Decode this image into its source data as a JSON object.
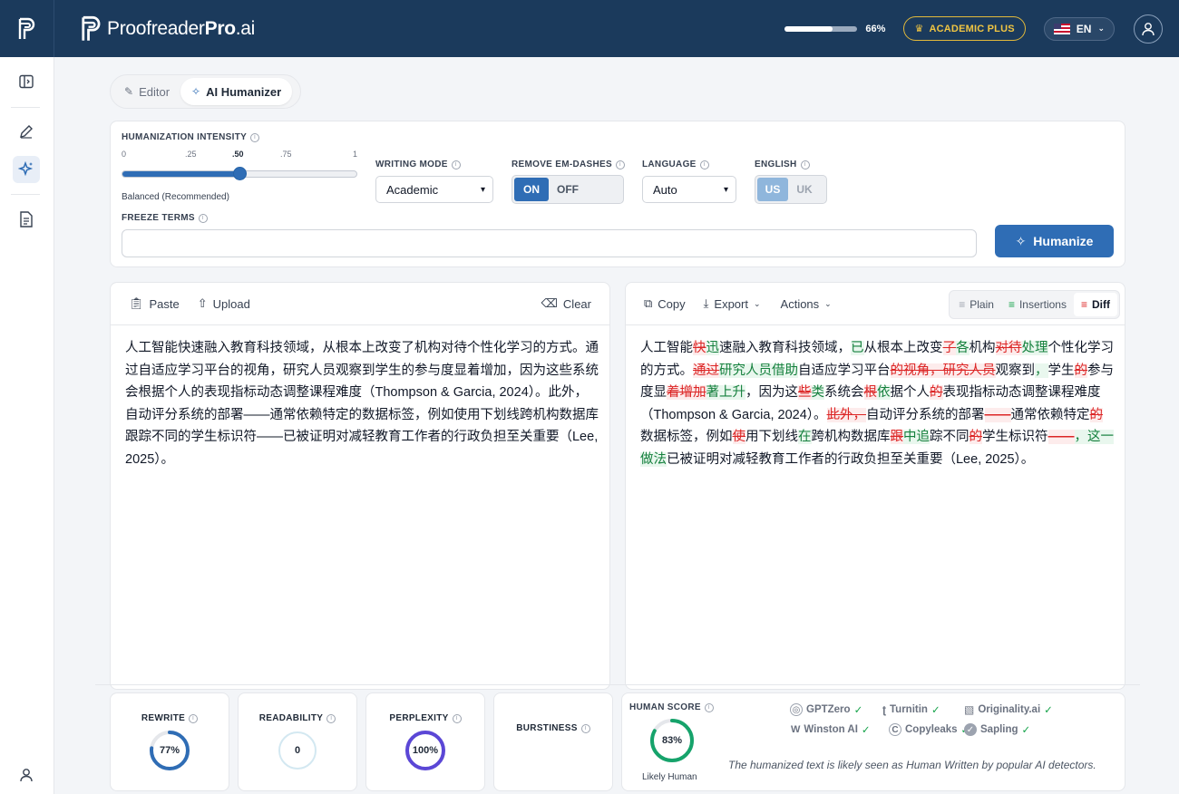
{
  "brand": {
    "name_regular": "Proofreader",
    "name_bold": "Pro",
    "name_tld": ".ai"
  },
  "topbar": {
    "credits_percent": 66,
    "credits_label": "66%",
    "plan_label": "ACADEMIC PLUS",
    "language_label": "EN"
  },
  "tabs": [
    {
      "label": "Editor"
    },
    {
      "label": "AI Humanizer"
    }
  ],
  "settings": {
    "intensity_label": "HUMANIZATION INTENSITY",
    "ticks": [
      "0",
      ".25",
      ".50",
      ".75",
      "1"
    ],
    "intensity_value": 0.5,
    "intensity_caption": "Balanced (Recommended)",
    "writing_mode_label": "WRITING MODE",
    "writing_mode_value": "Academic",
    "em_dash_label": "REMOVE EM-DASHES",
    "em_on": "ON",
    "em_off": "OFF",
    "language_label": "LANGUAGE",
    "language_value": "Auto",
    "english_label": "ENGLISH",
    "en_us": "US",
    "en_uk": "UK",
    "freeze_label": "FREEZE TERMS",
    "freeze_value": "",
    "humanize_button": "Humanize"
  },
  "input": {
    "paste": "Paste",
    "upload": "Upload",
    "clear": "Clear",
    "text": "人工智能快速融入教育科技领域，从根本上改变了机构对待个性化学习的方式。通过自适应学习平台的视角，研究人员观察到学生的参与度显着增加，因为这些系统会根据个人的表现指标动态调整课程难度（Thompson & Garcia, 2024）。此外，自动评分系统的部署——通常依赖特定的数据标签，例如使用下划线跨机构数据库跟踪不同的学生标识符——已被证明对减轻教育工作者的行政负担至关重要（Lee, 2025）。"
  },
  "output": {
    "copy": "Copy",
    "export": "Export",
    "actions": "Actions",
    "views": [
      "Plain",
      "Insertions",
      "Diff"
    ],
    "diff": [
      [
        "n",
        "人工智能"
      ],
      [
        "d",
        "快"
      ],
      [
        "i",
        "迅"
      ],
      [
        "n",
        "速融入教育科技领域，"
      ],
      [
        "i",
        "已"
      ],
      [
        "n",
        "从根本上改变"
      ],
      [
        "d",
        "了"
      ],
      [
        "i",
        "各"
      ],
      [
        "n",
        "机构"
      ],
      [
        "d",
        "对待"
      ],
      [
        "i",
        "处理"
      ],
      [
        "n",
        "个性化学习的方式。"
      ],
      [
        "d",
        "通过"
      ],
      [
        "i",
        "研究人员借助"
      ],
      [
        "n",
        "自适应学习平台"
      ],
      [
        "d",
        "的视角，研究人员"
      ],
      [
        "n",
        "观察到"
      ],
      [
        "i",
        "，"
      ],
      [
        "n",
        "学生"
      ],
      [
        "d",
        "的"
      ],
      [
        "n",
        "参与度显"
      ],
      [
        "d",
        "着增加"
      ],
      [
        "i",
        "著上升"
      ],
      [
        "n",
        "，因为这"
      ],
      [
        "d",
        "些"
      ],
      [
        "i",
        "类"
      ],
      [
        "n",
        "系统会"
      ],
      [
        "d",
        "根"
      ],
      [
        "i",
        "依"
      ],
      [
        "n",
        "据个人"
      ],
      [
        "d",
        "的"
      ],
      [
        "n",
        "表现指标动态调整课程难度（Thompson & Garcia, 2024）。"
      ],
      [
        "d",
        "此外，"
      ],
      [
        "n",
        "自动评分系统的部署"
      ],
      [
        "d",
        "——"
      ],
      [
        "n",
        "通常依赖特定"
      ],
      [
        "d",
        "的"
      ],
      [
        "n",
        "数据标签，例如"
      ],
      [
        "d",
        "使"
      ],
      [
        "n",
        "用下划线"
      ],
      [
        "i",
        "在"
      ],
      [
        "n",
        "跨机构数据库"
      ],
      [
        "d",
        "跟"
      ],
      [
        "i",
        "中追"
      ],
      [
        "n",
        "踪不同"
      ],
      [
        "d",
        "的"
      ],
      [
        "n",
        "学生标识符"
      ],
      [
        "d",
        "——"
      ],
      [
        "i",
        "，这一做法"
      ],
      [
        "n",
        "已被证明对减轻教育工作者的行政负担至关重要（Lee, 2025）。"
      ]
    ]
  },
  "metrics": {
    "rewrite": {
      "label": "REWRITE",
      "value": "77%",
      "pct": 77,
      "color": "#2f6db5"
    },
    "readability": {
      "label": "READABILITY",
      "value": "0",
      "pct": 0,
      "color": "#9ecbe0"
    },
    "perplexity": {
      "label": "PERPLEXITY",
      "value": "100%",
      "pct": 100,
      "color": "#5b47d6"
    },
    "burstiness": {
      "label": "BURSTINESS"
    },
    "human": {
      "label": "HUMAN SCORE",
      "value": "83%",
      "pct": 83,
      "color": "#16a36b",
      "caption": "Likely Human"
    }
  },
  "detectors": {
    "items": [
      "GPTZero",
      "Turnitin",
      "Originality.ai",
      "Winston AI",
      "Copyleaks",
      "Sapling"
    ],
    "note": "The humanized text is likely seen as Human Written by popular AI detectors."
  }
}
